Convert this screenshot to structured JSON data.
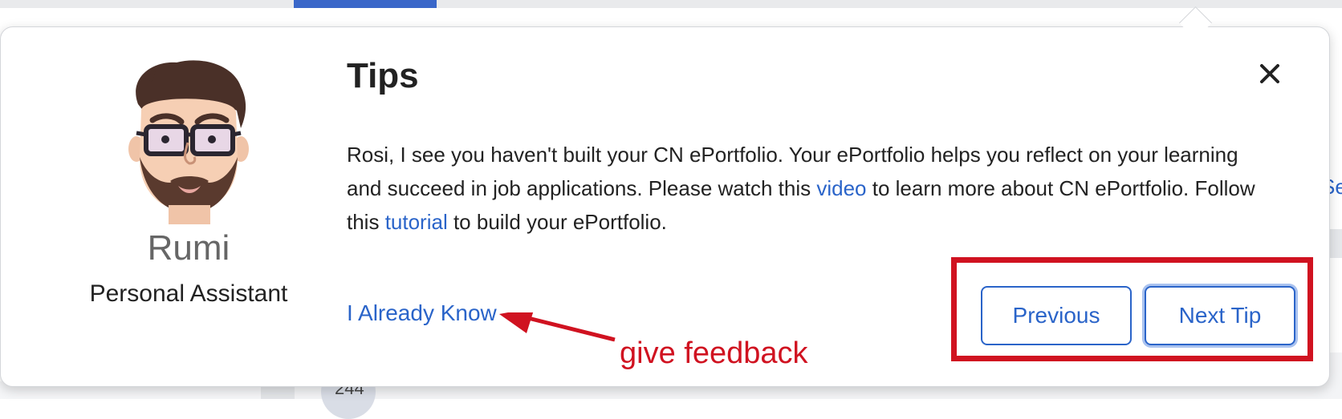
{
  "background": {
    "badge_count": "244",
    "side_link_fragment": "Se"
  },
  "assistant": {
    "name": "Rumi",
    "role": "Personal Assistant",
    "avatar_icon": "cartoon-assistant-avatar"
  },
  "tips": {
    "title": "Tips",
    "close_icon": "close-icon",
    "message": {
      "part1": "Rosi, I see you haven't built your CN ePortfolio. Your ePortfolio helps you reflect on your learning and succeed in job applications. Please watch this ",
      "video_link": "video",
      "part2": " to learn more about CN ePortfolio. Follow this ",
      "tutorial_link": "tutorial",
      "part3": " to build your ePortfolio."
    },
    "already_know_label": "I Already Know",
    "previous_label": "Previous",
    "next_label": "Next Tip"
  },
  "annotations": {
    "feedback_text": "give feedback",
    "color": "#d01220"
  },
  "colors": {
    "link": "#2a64c9",
    "accent": "#3a67c9",
    "annotation": "#d01220"
  }
}
